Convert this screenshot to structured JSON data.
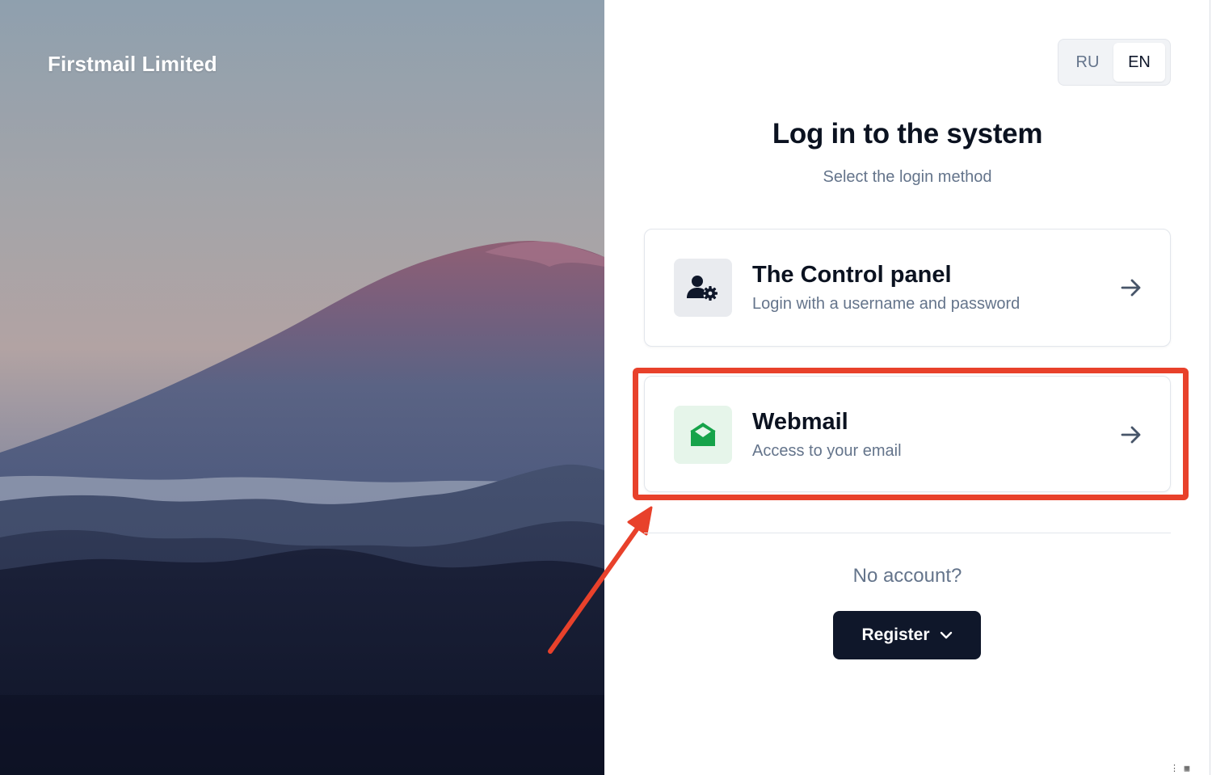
{
  "brand": {
    "name": "Firstmail Limited"
  },
  "language": {
    "options": [
      "RU",
      "EN"
    ],
    "selected": "EN"
  },
  "login": {
    "title": "Log in to the system",
    "subtitle": "Select the login method",
    "methods": [
      {
        "title": "The Control panel",
        "description": "Login with a username and password",
        "icon": "user-gear-icon"
      },
      {
        "title": "Webmail",
        "description": "Access to your email",
        "icon": "open-envelope-icon"
      }
    ]
  },
  "footer": {
    "no_account": "No account?",
    "register_label": "Register"
  },
  "annotation": {
    "highlight_color": "#e8412b",
    "highlighted_item": "Webmail"
  },
  "colors": {
    "primary_dark": "#0f172a",
    "muted_text": "#64748b",
    "webmail_green": "#16a34a"
  }
}
